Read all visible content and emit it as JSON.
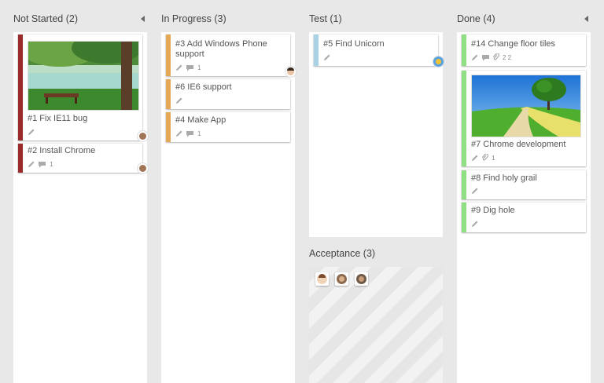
{
  "columns": [
    {
      "name": "Not Started (2)"
    },
    {
      "name": "In Progress (3)"
    },
    {
      "name": "Test (1)"
    },
    {
      "name": "Done (4)"
    }
  ],
  "acceptance": {
    "name": "Acceptance (3)"
  },
  "cards": {
    "c1": {
      "title": "#1 Fix IE11 bug"
    },
    "c2": {
      "title": "#2 Install Chrome",
      "comments": "1"
    },
    "c3": {
      "title_line1": "#3 Add Windows Phone",
      "title_line2": "support",
      "comments": "1"
    },
    "c6": {
      "title": "#6 IE6 support"
    },
    "c4": {
      "title": "#4 Make App",
      "comments": "1"
    },
    "c5": {
      "title": "#5 Find Unicorn"
    },
    "c14": {
      "title": "#14 Change floor tiles",
      "counts": "2 2"
    },
    "c7": {
      "title": "#7 Chrome development",
      "attachments": "1"
    },
    "c8": {
      "title": "#8 Find holy grail"
    },
    "c9": {
      "title": "#9 Dig hole"
    }
  },
  "colors": {
    "not_started": "#9b2a2a",
    "in_progress": "#e4a857",
    "test": "#a9d3e4",
    "done": "#8ee083"
  }
}
